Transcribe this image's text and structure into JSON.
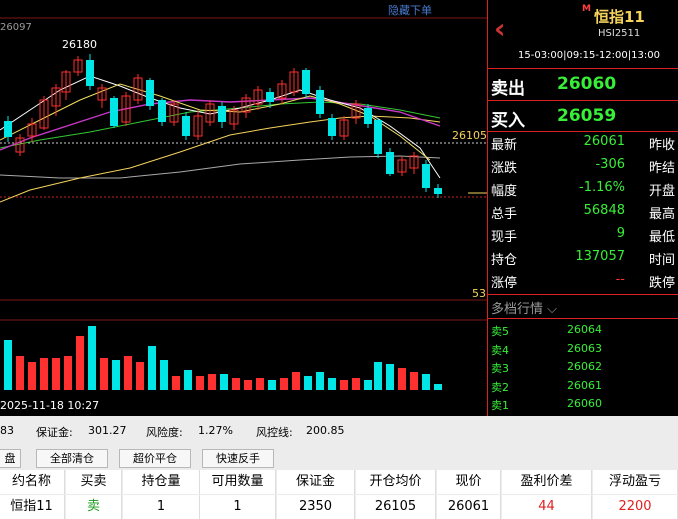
{
  "chart": {
    "hide_link": "隐藏下单",
    "top_price": "26097",
    "high_label": "26180",
    "price_tag": "26105",
    "volume_max": "53",
    "date": "2025-11-18 10:27"
  },
  "panel": {
    "title_badge": "M",
    "title": "恒指11",
    "code": "HSI2511",
    "session": "15-03:00|09:15-12:00|13:00",
    "sell_label": "卖出",
    "sell_price": "26060",
    "buy_label": "买入",
    "buy_price": "26059",
    "quotes": [
      {
        "label": "最新",
        "value": "26061",
        "label2": "昨收"
      },
      {
        "label": "涨跌",
        "value": "-306",
        "label2": "昨结"
      },
      {
        "label": "幅度",
        "value": "-1.16%",
        "label2": "开盘"
      },
      {
        "label": "总手",
        "value": "56848",
        "label2": "最高"
      },
      {
        "label": "现手",
        "value": "9",
        "label2": "最低"
      },
      {
        "label": "持仓",
        "value": "137057",
        "label2": "时间"
      },
      {
        "label": "涨停",
        "value": "--",
        "label2": "跌停"
      }
    ],
    "depth_title": "多档行情",
    "depth": [
      {
        "side": "卖5",
        "price": "26064"
      },
      {
        "side": "卖4",
        "price": "26063"
      },
      {
        "side": "卖3",
        "price": "26062"
      },
      {
        "side": "卖2",
        "price": "26061"
      },
      {
        "side": "卖1",
        "price": "26060"
      }
    ]
  },
  "account": {
    "balance": "83",
    "margin_label": "保证金:",
    "margin_value": "301.27",
    "risk_label": "风险度:",
    "risk_value": "1.27%",
    "control_label": "风控线:",
    "control_value": "200.85"
  },
  "toolbar": {
    "tab": "盘",
    "close_all": "全部清仓",
    "over_price_close": "超价平仓",
    "quick_reverse": "快速反手"
  },
  "positions": {
    "headers": [
      "约名称",
      "买卖",
      "持仓量",
      "可用数量",
      "保证金",
      "开仓均价",
      "现价",
      "盈利价差",
      "浮动盈亏"
    ],
    "row": [
      "恒指11",
      "卖",
      "1",
      "1",
      "2350",
      "26105",
      "26061",
      "44",
      "2200"
    ]
  },
  "colors": {
    "up": "#ff3030",
    "down": "#00e5e5",
    "green": "#38ef38",
    "gold": "#f6d35c"
  }
}
